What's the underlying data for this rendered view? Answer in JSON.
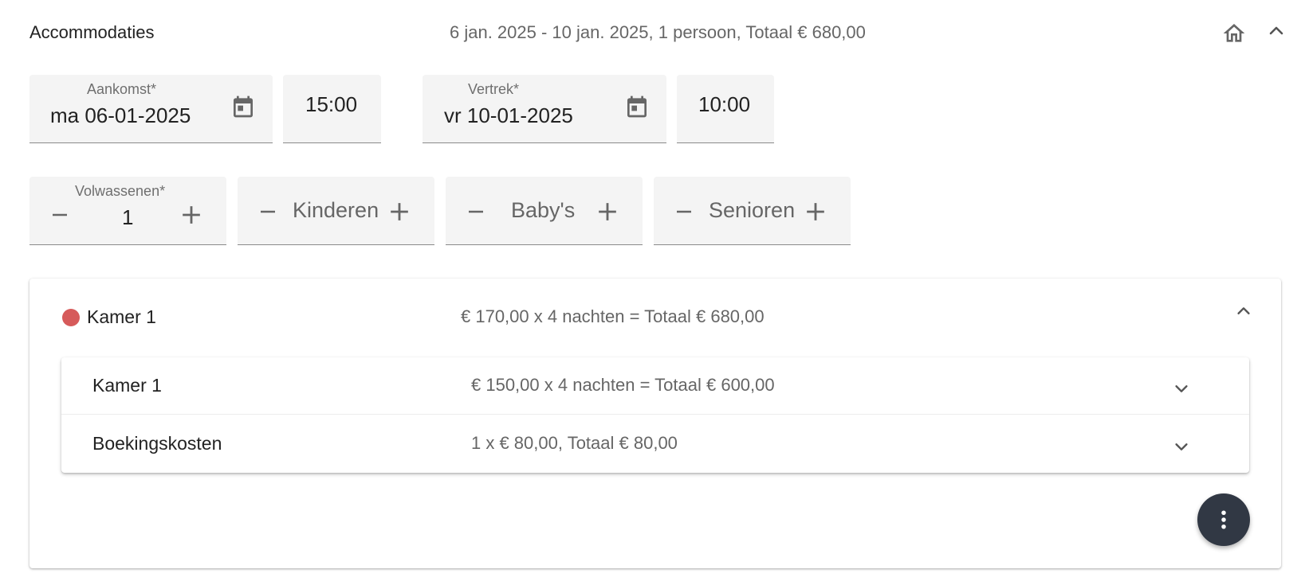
{
  "header": {
    "title": "Accommodaties",
    "summary": "6 jan. 2025 - 10 jan. 2025, 1 persoon, Totaal € 680,00",
    "home_icon": "home-icon",
    "collapse_icon": "chevron-up-icon"
  },
  "dates": {
    "arrival": {
      "label": "Aankomst*",
      "value": "ma 06-01-2025",
      "time": "15:00",
      "icon": "calendar-icon"
    },
    "departure": {
      "label": "Vertrek*",
      "value": "vr 10-01-2025",
      "time": "10:00",
      "icon": "calendar-icon"
    }
  },
  "guests": {
    "adults": {
      "label": "Volwassenen*",
      "value": "1"
    },
    "children": {
      "placeholder": "Kinderen"
    },
    "babies": {
      "placeholder": "Baby's"
    },
    "seniors": {
      "placeholder": "Senioren"
    },
    "minus_symbol": "−",
    "plus_symbol": "+"
  },
  "room": {
    "status_color": "#d65a5a",
    "title": "Kamer 1",
    "summary": "€ 170,00 x 4 nachten = Totaal € 680,00",
    "lines": [
      {
        "name": "Kamer 1",
        "summary": "€ 150,00 x 4 nachten = Totaal € 600,00"
      },
      {
        "name": "Boekingskosten",
        "summary": "1 x € 80,00, Totaal € 80,00"
      }
    ]
  },
  "fab": {
    "icon": "more-vertical-icon",
    "color": "#313844"
  }
}
